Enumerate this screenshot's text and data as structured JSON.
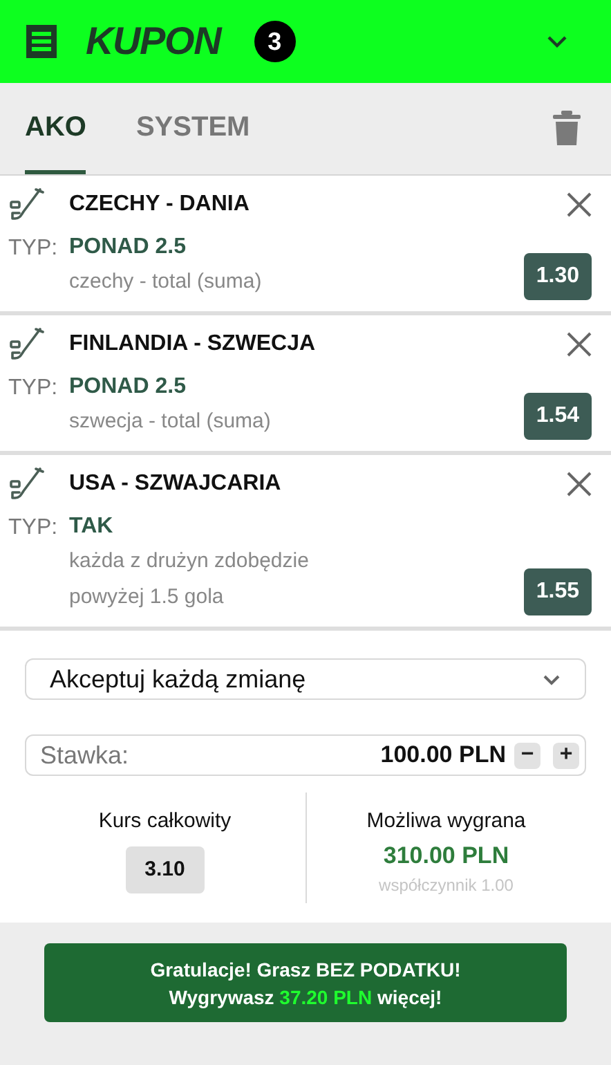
{
  "header": {
    "title": "KUPON",
    "count": "3",
    "expanded": true
  },
  "tabs": [
    {
      "label": "AKO",
      "selected": true
    },
    {
      "label": "SYSTEM",
      "selected": false
    }
  ],
  "bets": [
    {
      "match": "CZECHY - DANIA",
      "type_label": "TYP:",
      "pick": "PONAD 2.5",
      "market": "czechy - total (suma)",
      "odds": "1.30"
    },
    {
      "match": "FINLANDIA - SZWECJA",
      "type_label": "TYP:",
      "pick": "PONAD 2.5",
      "market": "szwecja - total (suma)",
      "odds": "1.54"
    },
    {
      "match": "USA - SZWAJCARIA",
      "type_label": "TYP:",
      "pick": "TAK",
      "market": "każda z drużyn zdobędzie powyżej 1.5 gola",
      "odds": "1.55"
    }
  ],
  "odds_change_select": {
    "value": "Akceptuj każdą zmianę"
  },
  "stake": {
    "label": "Stawka:",
    "value": "100.00 PLN",
    "minus": "−",
    "plus": "+"
  },
  "total_odds": {
    "label": "Kurs całkowity",
    "value": "3.10"
  },
  "possible_win": {
    "label": "Możliwa wygrana",
    "value": "310.00 PLN",
    "factor": "współczynnik 1.00"
  },
  "banner": {
    "line1": "Gratulacje! Grasz BEZ PODATKU!",
    "line2_before": "Wygrywasz ",
    "line2_highlight": "37.20 PLN",
    "line2_after": " więcej!"
  }
}
